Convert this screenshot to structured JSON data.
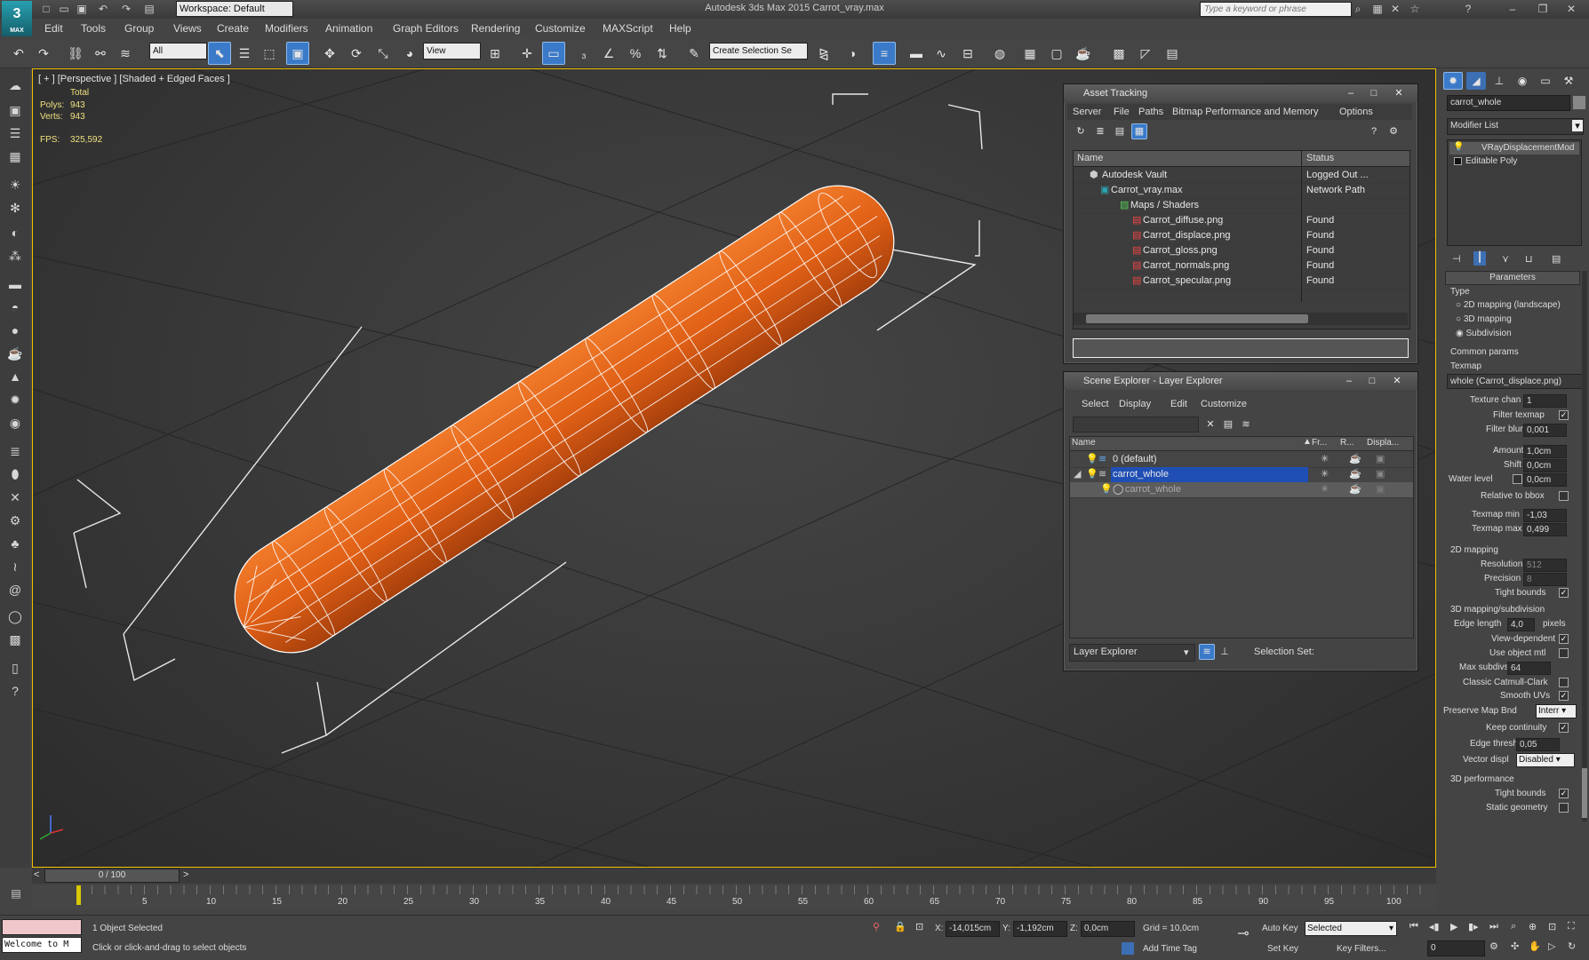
{
  "titlebar": {
    "workspace": "Workspace: Default",
    "app_title": "Autodesk 3ds Max  2015    Carrot_vray.max",
    "search_placeholder": "Type a keyword or phrase"
  },
  "menu": [
    "Edit",
    "Tools",
    "Group",
    "Views",
    "Create",
    "Modifiers",
    "Animation",
    "Graph Editors",
    "Rendering",
    "Customize",
    "MAXScript",
    "Help"
  ],
  "toolbar": {
    "filter": "All",
    "coord_system": "View",
    "named_selection": "Create Selection Se"
  },
  "viewport": {
    "label": "[ + ] [Perspective ] [Shaded + Edged Faces ]",
    "stats": {
      "total_label": "Total",
      "polys_label": "Polys:",
      "polys": "943",
      "verts_label": "Verts:",
      "verts": "943",
      "fps_label": "FPS:",
      "fps": "325,592"
    }
  },
  "asset_tracking": {
    "title": "Asset Tracking",
    "menu": [
      "Server",
      "File",
      "Paths",
      "Bitmap Performance and Memory",
      "Options"
    ],
    "col_name": "Name",
    "col_status": "Status",
    "rows": [
      {
        "name": "Autodesk Vault",
        "status": "Logged Out ..."
      },
      {
        "name": "Carrot_vray.max",
        "status": "Network Path"
      },
      {
        "name": "Maps / Shaders",
        "status": ""
      },
      {
        "name": "Carrot_diffuse.png",
        "status": "Found"
      },
      {
        "name": "Carrot_displace.png",
        "status": "Found"
      },
      {
        "name": "Carrot_gloss.png",
        "status": "Found"
      },
      {
        "name": "Carrot_normals.png",
        "status": "Found"
      },
      {
        "name": "Carrot_specular.png",
        "status": "Found"
      }
    ]
  },
  "scene_explorer": {
    "title": "Scene Explorer - Layer Explorer",
    "menu": [
      "Select",
      "Display",
      "Edit",
      "Customize"
    ],
    "col_name": "Name",
    "col_freeze": "Fr...",
    "col_render": "R...",
    "col_display": "Displa...",
    "rows": [
      {
        "name": "0 (default)"
      },
      {
        "name": "carrot_whole"
      },
      {
        "name": "carrot_whole"
      }
    ],
    "footer_mode": "Layer Explorer",
    "footer_selection": "Selection Set:"
  },
  "command_panel": {
    "object_name": "carrot_whole",
    "modifier_list": "Modifier List",
    "stack": [
      "VRayDisplacementMod",
      "Editable Poly"
    ],
    "rollout_title": "Parameters",
    "type_group": "Type",
    "type_options": [
      "2D mapping (landscape)",
      "3D mapping",
      "Subdivision"
    ],
    "common_group": "Common params",
    "texmap_label": "Texmap",
    "texmap_value": "whole (Carrot_displace.png)",
    "texture_chan_label": "Texture chan",
    "texture_chan": "1",
    "filter_texmap_label": "Filter texmap",
    "filter_blur_label": "Filter blur",
    "filter_blur": "0,001",
    "amount_label": "Amount",
    "amount": "1,0cm",
    "shift_label": "Shift",
    "shift": "0,0cm",
    "water_label": "Water level",
    "water": "0,0cm",
    "relative_label": "Relative to bbox",
    "texmap_min_label": "Texmap min",
    "texmap_min": "-1,03",
    "texmap_max_label": "Texmap max",
    "texmap_max": "0,499",
    "mapping2d_group": "2D mapping",
    "resolution_label": "Resolution",
    "resolution": "512",
    "precision_label": "Precision",
    "precision": "8",
    "tight_bounds_label": "Tight bounds",
    "mapping3d_group": "3D mapping/subdivision",
    "edge_length_label": "Edge length",
    "edge_length": "4,0",
    "pixels_label": "pixels",
    "view_dependent_label": "View-dependent",
    "use_object_mtl_label": "Use object mtl",
    "max_subdivs_label": "Max subdivs",
    "max_subdivs": "64",
    "catmull_label": "Classic Catmull-Clark",
    "smooth_uvs_label": "Smooth UVs",
    "preserve_label": "Preserve Map Bnd",
    "preserve_value": "Interr",
    "keep_continuity_label": "Keep continuity",
    "edge_thresh_label": "Edge thresh",
    "edge_thresh": "0,05",
    "vector_label": "Vector displ",
    "vector_value": "Disabled",
    "perf_group": "3D performance",
    "perf_tight_label": "Tight bounds",
    "static_geo_label": "Static geometry"
  },
  "timeline": {
    "frame": "0 / 100",
    "ticks": [
      "5",
      "10",
      "15",
      "20",
      "25",
      "30",
      "35",
      "40",
      "45",
      "50",
      "55",
      "60",
      "65",
      "70",
      "75",
      "80",
      "85",
      "90",
      "95",
      "100"
    ]
  },
  "status": {
    "welcome": "Welcome to M",
    "selection": "1 Object Selected",
    "prompt": "Click or click-and-drag to select objects",
    "x_label": "X:",
    "x": "-14,015cm",
    "y_label": "Y:",
    "y": "-1,192cm",
    "z_label": "Z:",
    "z": "0,0cm",
    "grid": "Grid = 10,0cm",
    "add_time_tag": "Add Time Tag",
    "auto_key": "Auto Key",
    "selected": "Selected",
    "set_key": "Set Key",
    "key_filters": "Key Filters...",
    "frame_field": "0"
  }
}
